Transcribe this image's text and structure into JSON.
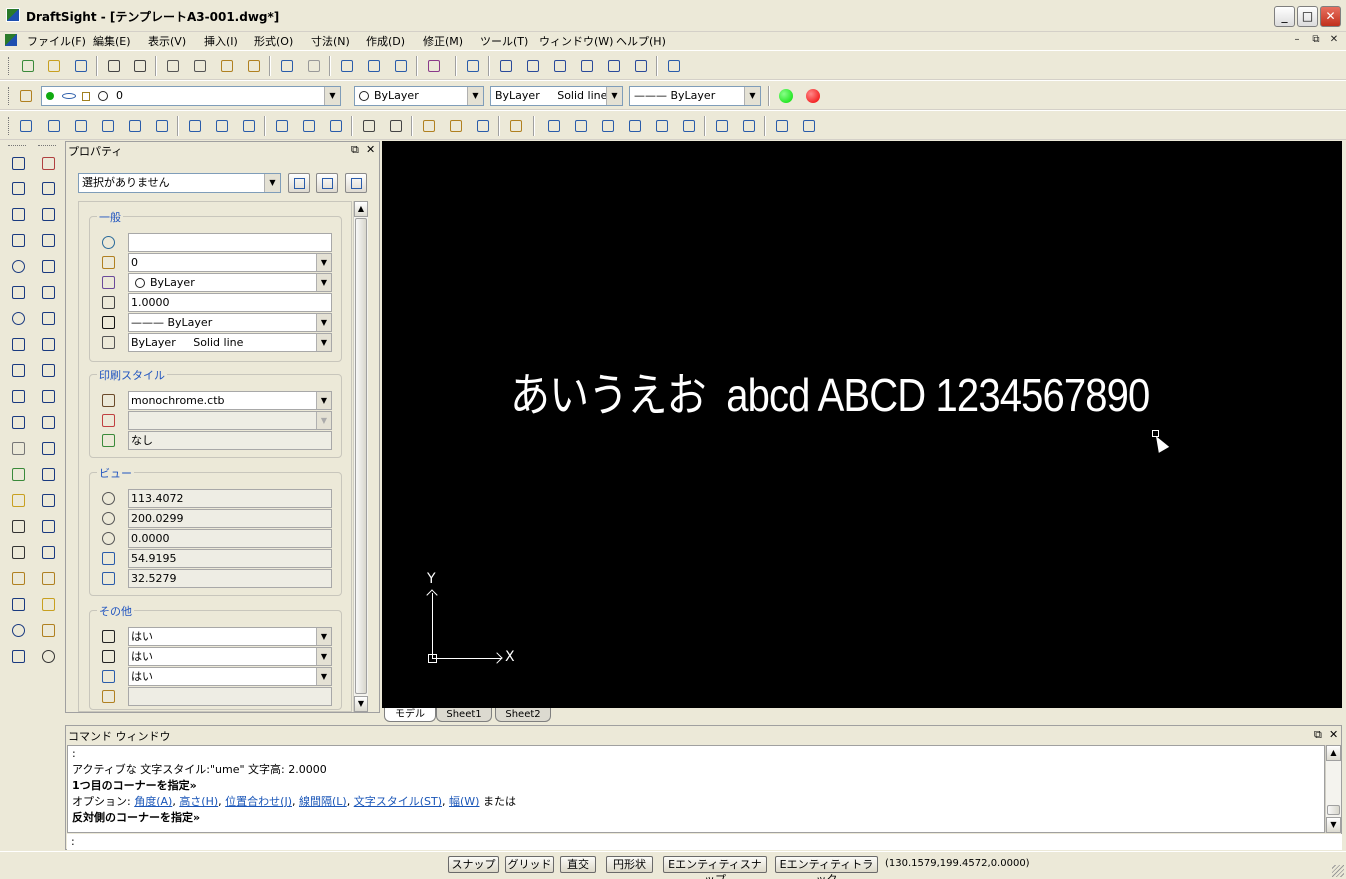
{
  "title_bar": {
    "title": "DraftSight - [テンプレートA3-001.dwg*]",
    "minimize": "_",
    "maximize": "□",
    "close": "✕"
  },
  "menu": [
    "ファイル(F)",
    "編集(E)",
    "表示(V)",
    "挿入(I)",
    "形式(O)",
    "寸法(N)",
    "作成(D)",
    "修正(M)",
    "ツール(T)",
    "ウィンドウ(W)",
    "ヘルプ(H)"
  ],
  "mdi": {
    "minimize": "–",
    "restore": "⧉",
    "close": "✕"
  },
  "layer_toolbar": {
    "layer_value": "0",
    "color_value": "ByLayer",
    "linestyle_value": "ByLayer     Solid line",
    "lineweight_value": "——— ByLayer",
    "status_colors": [
      "#00dd00",
      "#ee0000"
    ]
  },
  "properties": {
    "title": "プロパティ",
    "selection": "選択がありません",
    "general": {
      "title": "一般",
      "color": "",
      "layer": "0",
      "linecolor": "ByLayer",
      "scale": "1.0000",
      "lineweight": "——— ByLayer",
      "linestyle": "ByLayer     Solid line"
    },
    "print_style": {
      "title": "印刷スタイル",
      "table": "monochrome.ctb",
      "style": "",
      "none": "なし"
    },
    "view": {
      "title": "ビュー",
      "center_x": "113.4072",
      "center_y": "200.0299",
      "center_z": "0.0000",
      "width": "54.9195",
      "height": "32.5279"
    },
    "other": {
      "title": "その他",
      "ucs_icon_on": "はい",
      "ucs_icon_origin": "はい",
      "ucs_per_viewport": "はい",
      "ucs_name": ""
    }
  },
  "canvas": {
    "text": "あいうえお  abcd ABCD 1234567890",
    "axis_x": "X",
    "axis_y": "Y"
  },
  "tabs": [
    "モデル",
    "Sheet1",
    "Sheet2"
  ],
  "command_window": {
    "title": "コマンド ウィンドウ",
    "line0": ":",
    "line1": "アクティブな 文字スタイル:\"ume\" 文字高: 2.0000",
    "line2": "1つ目のコーナーを指定»",
    "line3_prefix": "オプション: ",
    "options": [
      "角度(A)",
      "高さ(H)",
      "位置合わせ(J)",
      "線間隔(L)",
      "文字スタイル(ST)",
      "幅(W)"
    ],
    "line3_suffix": " または",
    "line4": "反対側のコーナーを指定»",
    "input": ":"
  },
  "statusbar": {
    "buttons": [
      "スナップ",
      "グリッド",
      "直交",
      "円形状",
      "Eエンティティスナップ",
      "Eエンティティトラック"
    ],
    "coords": "(130.1579,199.4572,0.0000)"
  }
}
